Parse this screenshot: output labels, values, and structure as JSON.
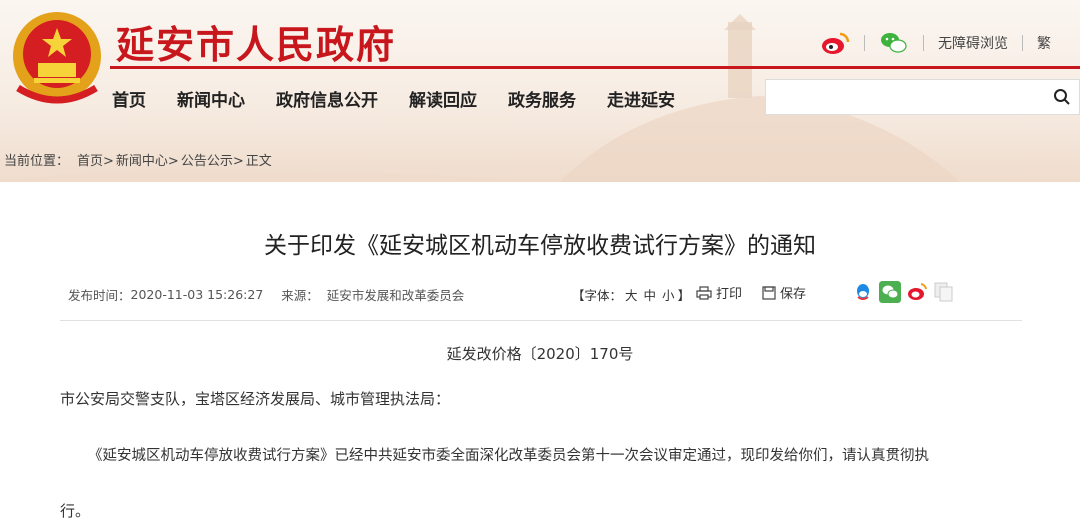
{
  "header": {
    "site_title": "延安市人民政府",
    "tools": {
      "accessibility": "无障碍浏览",
      "traditional": "繁"
    },
    "nav": [
      "首页",
      "新闻中心",
      "政府信息公开",
      "解读回应",
      "政务服务",
      "走进延安"
    ],
    "search_placeholder": ""
  },
  "breadcrumb": {
    "label": "当前位置：",
    "items": [
      "首页>",
      "新闻中心>",
      "公告公示>",
      "正文"
    ]
  },
  "article": {
    "title": "关于印发《延安城区机动车停放收费试行方案》的通知",
    "meta": {
      "publish_label": "发布时间：",
      "publish_time": "2020-11-03 15:26:27",
      "source_label": "来源：",
      "source": "延安市发展和改革委员会",
      "font_label_open": "【字体：",
      "font_large": "大",
      "font_medium": "中",
      "font_small": "小",
      "font_label_close": "】",
      "print": "打印",
      "save": "保存"
    },
    "doc_number": "延发改价格〔2020〕170号",
    "recipients": "市公安局交警支队，宝塔区经济发展局、城市管理执法局：",
    "paragraph": "《延安城区机动车停放收费试行方案》已经中共延安市委全面深化改革委员会第十一次会议审定通过，现印发给你们，请认真贯彻执",
    "paragraph_end": "行。"
  },
  "colors": {
    "brand_red": "#c8161d",
    "header_bg": "#f6ebe1"
  },
  "icons": [
    "emblem-icon",
    "weibo-icon",
    "wechat-icon",
    "search-icon",
    "print-icon",
    "save-icon",
    "qq-share-icon",
    "wechat-share-icon",
    "weibo-share-icon",
    "copy-share-icon"
  ]
}
